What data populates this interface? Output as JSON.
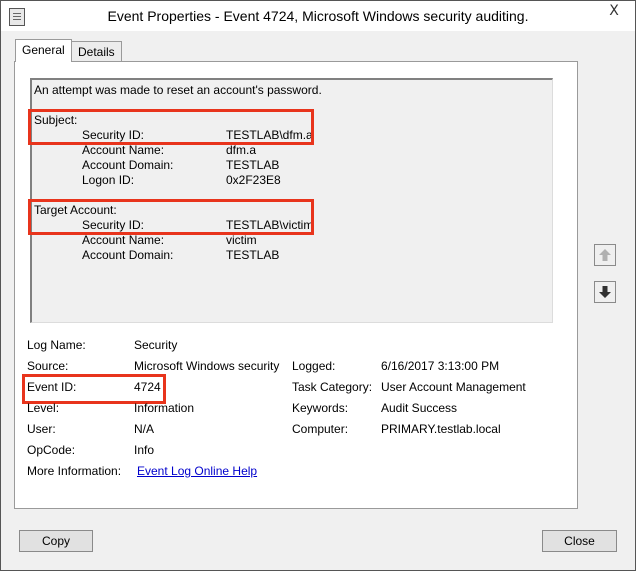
{
  "window": {
    "title": "Event Properties - Event 4724, Microsoft Windows security auditing.",
    "close_glyph": "X"
  },
  "tabs": [
    {
      "label": "General",
      "active": true
    },
    {
      "label": "Details",
      "active": false
    }
  ],
  "description": {
    "intro": "An attempt was made to reset an account's password.",
    "subject_header": "Subject:",
    "subject": {
      "security_id_label": "Security ID:",
      "security_id": "TESTLAB\\dfm.a",
      "account_name_label": "Account Name:",
      "account_name": "dfm.a",
      "account_domain_label": "Account Domain:",
      "account_domain": "TESTLAB",
      "logon_id_label": "Logon ID:",
      "logon_id": "0x2F23E8"
    },
    "target_header": "Target Account:",
    "target": {
      "security_id_label": "Security ID:",
      "security_id": "TESTLAB\\victim",
      "account_name_label": "Account Name:",
      "account_name": "victim",
      "account_domain_label": "Account Domain:",
      "account_domain": "TESTLAB"
    }
  },
  "fields": {
    "log_name_label": "Log Name:",
    "log_name": "Security",
    "source_label": "Source:",
    "source": "Microsoft Windows security",
    "logged_label": "Logged:",
    "logged": "6/16/2017 3:13:00 PM",
    "event_id_label": "Event ID:",
    "event_id": "4724",
    "task_category_label": "Task Category:",
    "task_category": "User Account Management",
    "level_label": "Level:",
    "level": "Information",
    "keywords_label": "Keywords:",
    "keywords": "Audit Success",
    "user_label": "User:",
    "user": "N/A",
    "computer_label": "Computer:",
    "computer": "PRIMARY.testlab.local",
    "opcode_label": "OpCode:",
    "opcode": "Info",
    "more_info_label": "More Information:",
    "more_info_link": "Event Log Online Help"
  },
  "buttons": {
    "copy": "Copy",
    "close": "Close"
  },
  "colors": {
    "highlight": "#e8341c",
    "link": "#0000cc"
  }
}
